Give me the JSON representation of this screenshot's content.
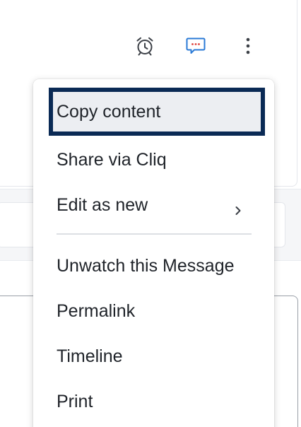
{
  "toolbar": {
    "icons": [
      "alarm-clock-icon",
      "comment-icon",
      "more-vertical-icon"
    ],
    "accent_color": "#2a7ad6",
    "dots_color": "#e0423b"
  },
  "menu": {
    "items": [
      {
        "label": "Copy content",
        "focused": true
      },
      {
        "label": "Share via Cliq"
      },
      {
        "label": "Edit as new",
        "has_submenu": true
      },
      {
        "label": "Unwatch this Message"
      },
      {
        "label": "Permalink"
      },
      {
        "label": "Timeline"
      },
      {
        "label": "Print"
      }
    ],
    "focus_color": "#0a2a55"
  }
}
